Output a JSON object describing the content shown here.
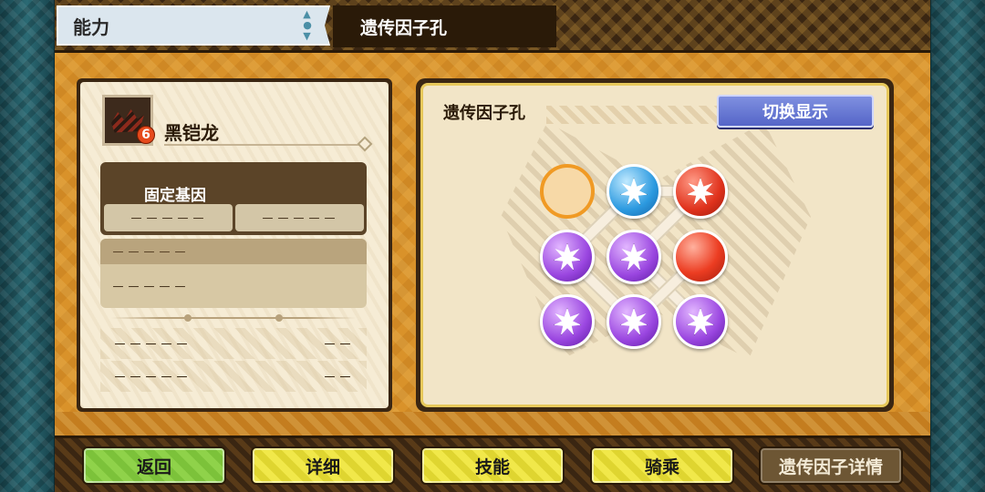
{
  "header": {
    "ability_tab": "能力",
    "title": "遗传因子孔"
  },
  "monster": {
    "name": "黑铠龙",
    "rarity": "6"
  },
  "genes": {
    "title": "固定基因",
    "slot_a": "－－－－－",
    "slot_b": "－－－－－"
  },
  "info": {
    "head": "－－－－－",
    "body": "－－－－－"
  },
  "stats": [
    {
      "label": "－－－－－",
      "value": "－－"
    },
    {
      "label": "－－－－－",
      "value": "－－"
    }
  ],
  "gene_panel": {
    "title": "遗传因子孔",
    "toggle_label": "切换显示",
    "slots": [
      {
        "type": "empty",
        "name": "empty-slot"
      },
      {
        "type": "blue",
        "name": "blue-gene-slot"
      },
      {
        "type": "red",
        "name": "red-gene-slot"
      },
      {
        "type": "purple",
        "name": "purple-gene-slot"
      },
      {
        "type": "purple",
        "name": "purple-gene-slot"
      },
      {
        "type": "red-plain",
        "name": "red-plain-slot"
      },
      {
        "type": "purple",
        "name": "purple-gene-slot"
      },
      {
        "type": "purple",
        "name": "purple-gene-slot"
      },
      {
        "type": "purple",
        "name": "purple-gene-slot"
      }
    ]
  },
  "buttons": {
    "back": "返回",
    "detail": "详细",
    "skills": "技能",
    "ride": "骑乘",
    "gene_detail": "遗传因子详情"
  },
  "colors": {
    "frame_orange": "#d9922a",
    "panel_cream": "#f6ecd5",
    "toggle_blue": "#5565c8",
    "button_green": "#8fd24a",
    "button_yellow": "#f1e84a"
  }
}
